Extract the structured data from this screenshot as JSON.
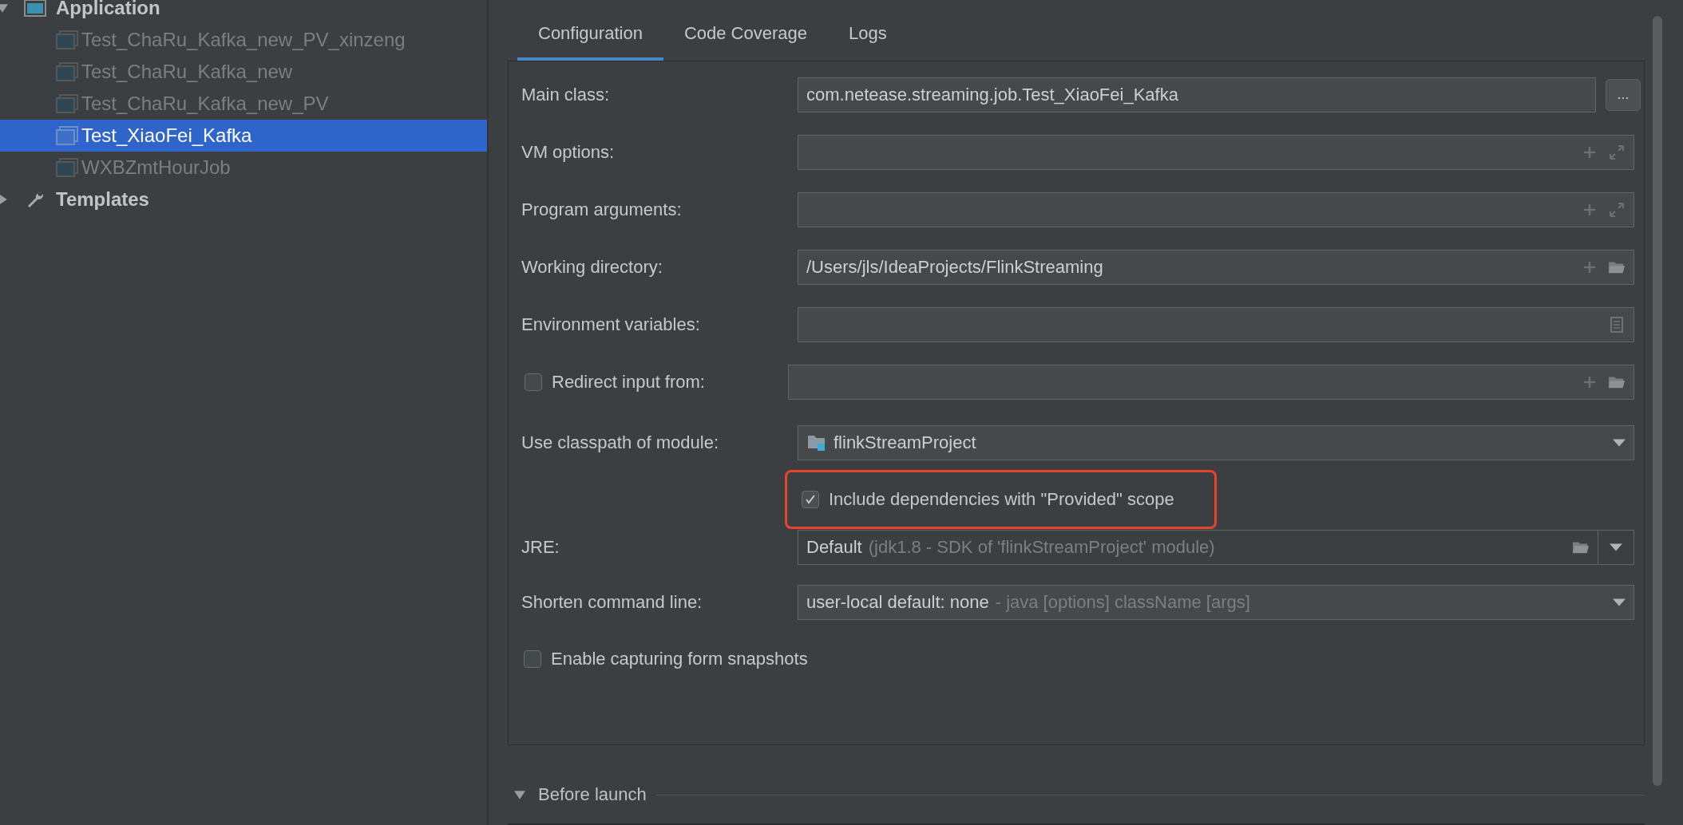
{
  "tree": [
    {
      "kind": "app-group",
      "label": "Application",
      "expanded": true,
      "children": [
        {
          "label": "Test_ChaRu_Kafka_new_PV_xinzeng",
          "selected": false,
          "disabled": true
        },
        {
          "label": "Test_ChaRu_Kafka_new",
          "selected": false,
          "disabled": true
        },
        {
          "label": "Test_ChaRu_Kafka_new_PV",
          "selected": false,
          "disabled": true
        },
        {
          "label": "Test_XiaoFei_Kafka",
          "selected": true,
          "disabled": false
        },
        {
          "label": "WXBZmtHourJob",
          "selected": false,
          "disabled": true
        }
      ]
    },
    {
      "kind": "tool-group",
      "label": "Templates",
      "expanded": false
    }
  ],
  "tabs": [
    {
      "label": "Configuration",
      "selected": true
    },
    {
      "label": "Code Coverage",
      "selected": false
    },
    {
      "label": "Logs",
      "selected": false
    }
  ],
  "form": [
    {
      "kind": "field",
      "label": "Main class:",
      "value": "com.netease.streaming.job.Test_XiaoFei_Kafka",
      "button": "..."
    },
    {
      "kind": "field",
      "label": "VM options:",
      "actions": [
        {
          "kind": "add"
        },
        {
          "kind": "expand"
        }
      ]
    },
    {
      "kind": "field",
      "label": "Program arguments:",
      "actions": [
        {
          "kind": "add"
        },
        {
          "kind": "expand"
        }
      ]
    },
    {
      "kind": "field",
      "label": "Working directory:",
      "value": "/Users/jls/IdeaProjects/FlinkStreaming",
      "actions": [
        {
          "kind": "add"
        },
        {
          "kind": "folder"
        }
      ]
    },
    {
      "kind": "field",
      "label": "Environment variables:",
      "actions": [
        {
          "kind": "document"
        }
      ]
    },
    {
      "kind": "checkbox-field",
      "label": "Redirect input from:",
      "checked": false,
      "actions": [
        {
          "kind": "add"
        },
        {
          "kind": "folder"
        }
      ]
    },
    {
      "kind": "dropdown",
      "label": "Use classpath of module:",
      "value": "flinkStreamProject",
      "module_icon": true
    },
    {
      "kind": "checkbox",
      "label": "Include dependencies with \"Provided\" scope",
      "checked": true,
      "highlighted": true
    },
    {
      "kind": "jre",
      "label": "JRE:",
      "value": "Default",
      "hint": "(jdk1.8 - SDK of 'flinkStreamProject' module)"
    },
    {
      "kind": "dropdown",
      "label": "Shorten command line:",
      "value": "user-local default: none",
      "hint": "- java [options] className [args]"
    },
    {
      "kind": "checkbox",
      "label": "Enable capturing form snapshots",
      "checked": false,
      "highlighted": false
    }
  ],
  "before_launch": {
    "label": "Before launch",
    "expanded": true
  }
}
